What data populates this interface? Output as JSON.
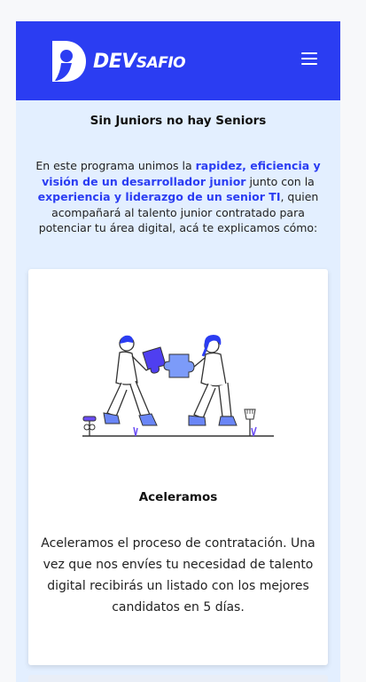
{
  "brand": {
    "logo_dev": "DEV",
    "logo_safio": "SAFIO",
    "primary_color": "#2b3df2"
  },
  "nav": {
    "menu_icon": "hamburger-menu-icon"
  },
  "section": {
    "title": "Sin Juniors no hay Seniors"
  },
  "intro": {
    "p1": "En este programa unimos la ",
    "h1": "rapidez, eficiencia y visión de un desarrollador junior",
    "p2": " junto con la ",
    "h2": "experiencia y liderazgo de un senior TI",
    "p3": ", quien acompañará al talento junior contratado para potenciar tu área digital, acá te explicamos cómo:"
  },
  "card": {
    "illustration": "people-assembling-puzzle-illustration",
    "title": "Aceleramos",
    "text": "Aceleramos el proceso de contratación. Una vez que nos envíes tu necesidad de talento digital recibirás un listado con los mejores candidatos en 5 días."
  }
}
